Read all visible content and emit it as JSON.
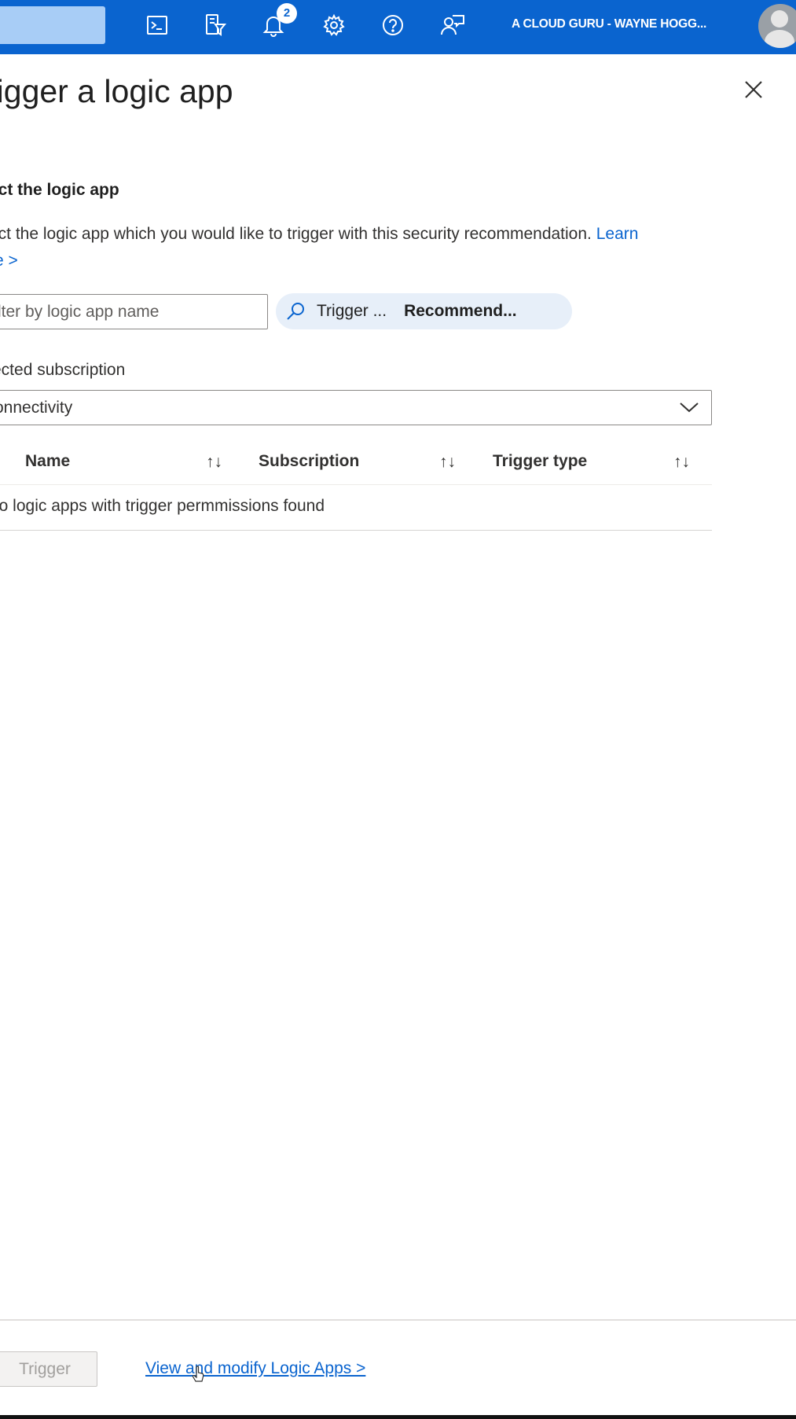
{
  "topbar": {
    "account": "A CLOUD GURU - WAYNE HOGG...",
    "notification_count": "2",
    "icons": [
      "cloud-shell-icon",
      "directory-filter-icon",
      "bell-icon",
      "gear-icon",
      "help-icon",
      "feedback-icon"
    ],
    "brand_color": "#0a64cf"
  },
  "panel": {
    "title": "rigger a logic app",
    "section_title": "ect the logic app",
    "description": "ect the logic app which you would like to trigger with this security recommendation.",
    "learn_more_a": "Learn",
    "learn_more_b": "re >",
    "filter_placeholder": "lter by logic app name",
    "pill_label": "Trigger ...",
    "pill_value": "Recommend...",
    "subscription_label": "ected subscription",
    "subscription_value": "onnectivity",
    "table": {
      "columns": [
        "Name",
        "Subscription",
        "Trigger type"
      ],
      "empty_message": "lo logic apps with trigger permmissions found"
    },
    "footer": {
      "trigger_button": "Trigger",
      "link": "View and modify Logic Apps >"
    }
  }
}
